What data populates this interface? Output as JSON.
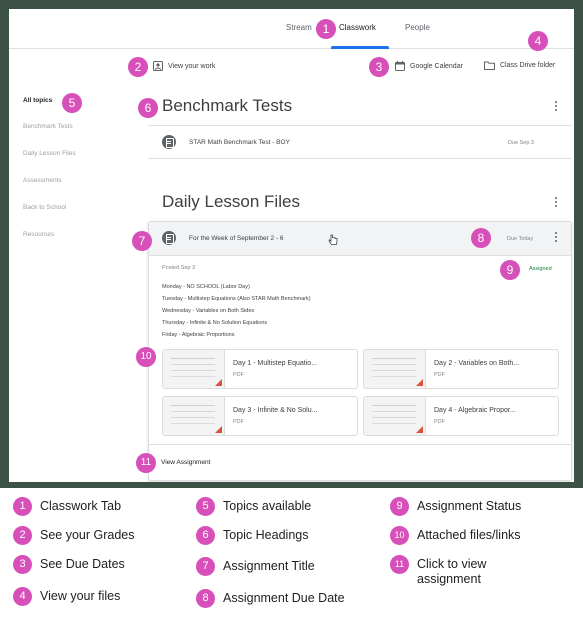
{
  "nav": {
    "tabs": [
      {
        "label": "Stream"
      },
      {
        "label": "Classwork"
      },
      {
        "label": "People"
      }
    ]
  },
  "actions": {
    "view_work": "View your work",
    "calendar": "Google Calendar",
    "drive": "Class Drive folder"
  },
  "sidebar": {
    "items": [
      {
        "label": "All topics"
      },
      {
        "label": "Benchmark Tests"
      },
      {
        "label": "Daily Lesson Files"
      },
      {
        "label": "Assessments"
      },
      {
        "label": "Back to School"
      },
      {
        "label": "Resources"
      }
    ]
  },
  "topics": [
    {
      "title": "Benchmark Tests",
      "assignment": {
        "title": "STAR Math Benchmark Test - BOY",
        "due": "Due Sep 3"
      }
    },
    {
      "title": "Daily Lesson Files",
      "assignment": {
        "title": "For the Week of September 2 - 6",
        "due": "Due Today",
        "posted": "Posted Sep 3",
        "status": "Assigned",
        "description": [
          "Monday - NO SCHOOL (Labor Day)",
          "Tuesday - Multistep Equations (Also STAR Math Benchmark)",
          "Wednesday - Variables on Both Sides",
          "Thursday - Infinite & No Solution Equations",
          "Friday - Algebraic Proportions"
        ],
        "attachments": [
          {
            "title": "Day 1 - Multistep Equatio...",
            "type": "PDF"
          },
          {
            "title": "Day 2 - Variables on Both...",
            "type": "PDF"
          },
          {
            "title": "Day 3 - Infinite & No Solu...",
            "type": "PDF"
          },
          {
            "title": "Day 4 - Algebraic Propor...",
            "type": "PDF"
          }
        ],
        "view_link": "View Assignment"
      }
    }
  ],
  "callouts": [
    "1",
    "2",
    "3",
    "4",
    "5",
    "6",
    "7",
    "8",
    "9",
    "10",
    "11"
  ],
  "legend": [
    {
      "num": "1",
      "label": "Classwork Tab"
    },
    {
      "num": "2",
      "label": "See your Grades"
    },
    {
      "num": "3",
      "label": "See Due Dates"
    },
    {
      "num": "4",
      "label": "View your files"
    },
    {
      "num": "5",
      "label": "Topics available"
    },
    {
      "num": "6",
      "label": "Topic Headings"
    },
    {
      "num": "7",
      "label": "Assignment Title"
    },
    {
      "num": "8",
      "label": "Assignment Due Date"
    },
    {
      "num": "9",
      "label": "Assignment Status"
    },
    {
      "num": "10",
      "label": "Attached files/links"
    },
    {
      "num": "11",
      "label": "Click to view assignment"
    }
  ],
  "colors": {
    "callout": "#d74fb8",
    "frame": "#3d5247",
    "accent": "#1a73e8",
    "status": "#188038"
  }
}
